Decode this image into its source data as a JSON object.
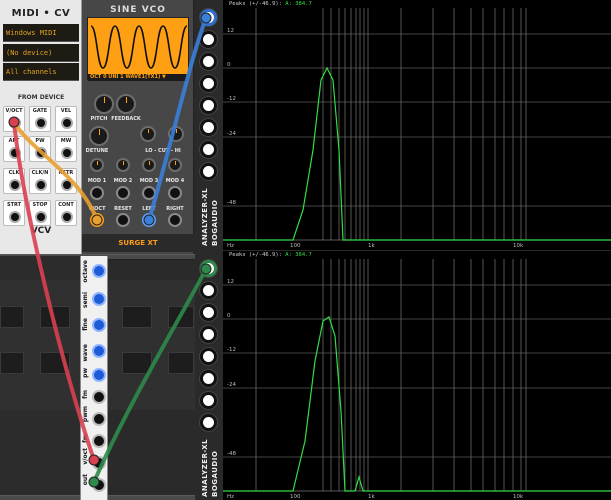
{
  "midi_cv": {
    "title": "MIDI • CV",
    "driver": "Windows MIDI",
    "device": "(No device)",
    "channel": "All channels",
    "section_label": "FROM DEVICE",
    "jacks": [
      "V/OCT",
      "GATE",
      "VEL",
      "AFT",
      "PW",
      "MW",
      "CLK",
      "CLK/N",
      "RETR",
      "STRT",
      "STOP",
      "CONT"
    ],
    "brand": "VCV"
  },
  "surge_vco": {
    "title": "SINE VCO",
    "wave_bar": "OCT 0  UNI 1  WAVE1(TX1) ▼",
    "knob_labels": {
      "pitch": "PITCH",
      "feedback": "FEEDBACK",
      "detune": "DETUNE",
      "lo_cut_hi": "LO - CUT - HI"
    },
    "mod_labels": [
      "MOD 1",
      "MOD 2",
      "MOD 3",
      "MOD 4"
    ],
    "jack_labels": [
      "V/OCT",
      "RESET",
      "LEFT",
      "RIGHT"
    ],
    "brand": "SURGE XT"
  },
  "analyzers": [
    {
      "peaks_label": "Peaks (+/-46.9):",
      "peak_channel": "A:",
      "peak_value": "384.7",
      "side_label_1": "ANALYZER-XL",
      "side_label_2": "BOGAUDIO",
      "db_labels": [
        "12",
        "0",
        "-12",
        "-24",
        "-48"
      ],
      "freq_labels": [
        "Hz",
        "100",
        "1k",
        "10k"
      ],
      "trace_color": "#33dd44"
    },
    {
      "peaks_label": "Peaks (+/-46.9):",
      "peak_channel": "A:",
      "peak_value": "384.7",
      "side_label_1": "ANALYZER-XL",
      "side_label_2": "BOGAUDIO",
      "db_labels": [
        "12",
        "0",
        "-12",
        "-24",
        "-48"
      ],
      "freq_labels": [
        "Hz",
        "100",
        "1k",
        "10k"
      ],
      "trace_color": "#33dd44"
    }
  ],
  "vco2": {
    "knob_labels": [
      "octave",
      "semi",
      "fine",
      "wave",
      "pw"
    ],
    "jack_labels": [
      "fm",
      "pwm",
      "fm",
      "v/oct",
      "out"
    ]
  },
  "cables": {
    "red": "#d94050",
    "orange": "#e8a030",
    "blue": "#3a80d8",
    "green": "#2e8a4a"
  }
}
